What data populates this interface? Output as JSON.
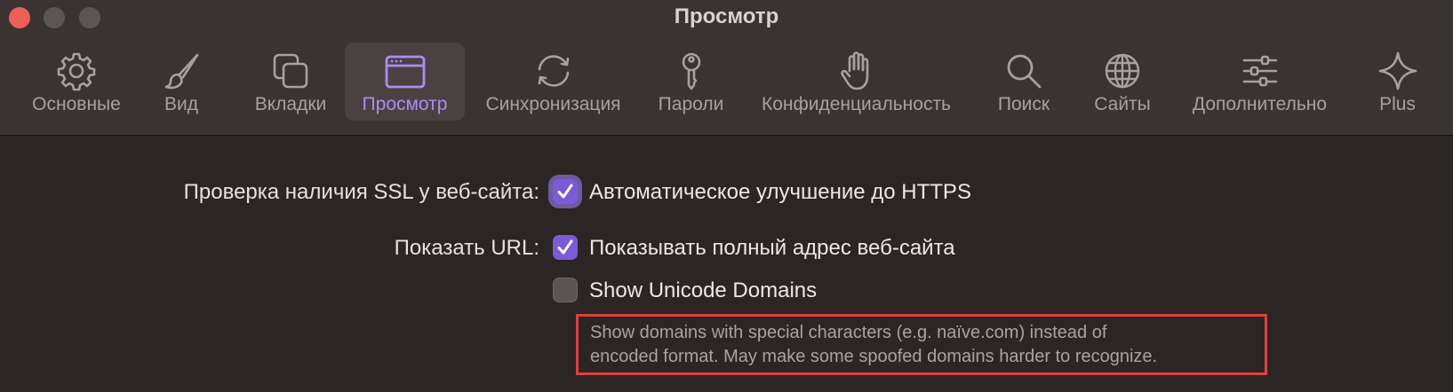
{
  "window": {
    "title": "Просмотр"
  },
  "toolbar": {
    "items": [
      {
        "label": "Основные",
        "icon": "gear-icon"
      },
      {
        "label": "Вид",
        "icon": "paintbrush-icon"
      },
      {
        "label": "Вкладки",
        "icon": "tabs-icon"
      },
      {
        "label": "Просмотр",
        "icon": "browser-window-icon",
        "active": true
      },
      {
        "label": "Синхронизация",
        "icon": "sync-icon"
      },
      {
        "label": "Пароли",
        "icon": "key-icon"
      },
      {
        "label": "Конфиденциальность",
        "icon": "hand-icon"
      },
      {
        "label": "Поиск",
        "icon": "search-icon"
      },
      {
        "label": "Сайты",
        "icon": "globe-icon"
      },
      {
        "label": "Дополнительно",
        "icon": "sliders-icon"
      },
      {
        "label": "Plus",
        "icon": "sparkle-icon"
      }
    ]
  },
  "settings": {
    "ssl": {
      "label": "Проверка наличия SSL у веб-сайта:",
      "checkbox_label": "Автоматическое улучшение до HTTPS",
      "checked": true
    },
    "url": {
      "label": "Показать URL:",
      "full_address_label": "Показывать полный адрес веб-сайта",
      "full_address_checked": true,
      "unicode_label": "Show Unicode Domains",
      "unicode_checked": false,
      "unicode_description_line1": "Show domains with special characters (e.g. naïve.com) instead of",
      "unicode_description_line2": "encoded format. May make some spoofed domains harder to recognize."
    }
  },
  "colors": {
    "accent": "#7c5bd6",
    "active_label": "#a98ef5",
    "highlight_border": "#e0413d"
  }
}
